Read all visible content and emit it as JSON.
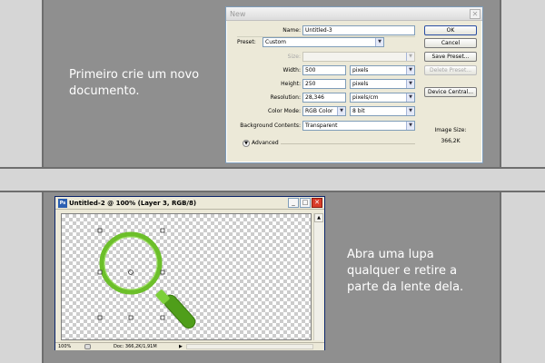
{
  "captions": {
    "step1": "Primeiro crie um novo documento.",
    "step2": "Abra uma lupa qualquer e retire a parte da lente dela."
  },
  "new_dialog": {
    "title": "New",
    "close_glyph": "✕",
    "name_label": "Name:",
    "name_value": "Untitled-3",
    "preset_label": "Preset:",
    "preset_value": "Custom",
    "size_label": "Size:",
    "size_value": "",
    "width_label": "Width:",
    "width_value": "500",
    "width_unit": "pixels",
    "height_label": "Height:",
    "height_value": "250",
    "height_unit": "pixels",
    "resolution_label": "Resolution:",
    "resolution_value": "28,346",
    "resolution_unit": "pixels/cm",
    "color_mode_label": "Color Mode:",
    "color_mode_value": "RGB Color",
    "bit_depth_value": "8 bit",
    "bg_label": "Background Contents:",
    "bg_value": "Transparent",
    "advanced_label": "Advanced",
    "buttons": {
      "ok": "OK",
      "cancel": "Cancel",
      "save_preset": "Save Preset...",
      "delete_preset": "Delete Preset...",
      "device_central": "Device Central..."
    },
    "image_size_label": "Image Size:",
    "image_size_value": "366,2K"
  },
  "doc_window": {
    "title": "Untitled-2 @ 100% (Layer 3, RGB/8)",
    "app_icon": "Ps",
    "minimize_glyph": "_",
    "maximize_glyph": "□",
    "close_glyph": "✕",
    "zoom": "100%",
    "doc_size": "Doc: 366,2K/1,91M",
    "status_arrow": "▶",
    "scroll_up": "▲"
  },
  "colors": {
    "magnifier_ring": "#6cbf2a",
    "magnifier_handle": "#4f9e1a"
  },
  "icons": {
    "dropdown": "▼"
  }
}
